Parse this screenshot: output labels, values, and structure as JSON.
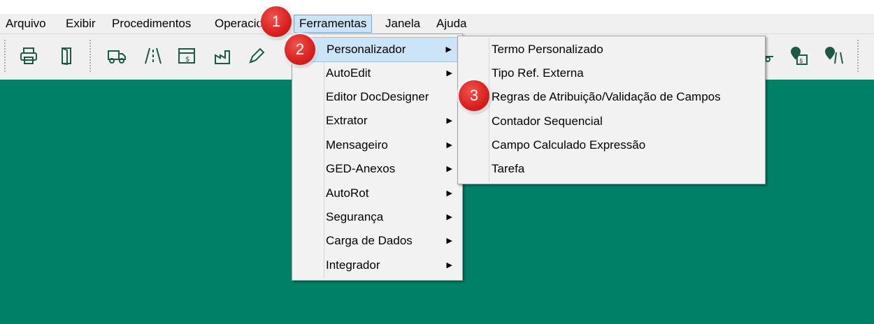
{
  "menubar": {
    "items": [
      "Arquivo",
      "Exibir",
      "Procedimentos",
      "Operacional",
      "Ferramentas",
      "Janela",
      "Ajuda"
    ]
  },
  "toolbar": {
    "icons": [
      "printer-icon",
      "door-exit-icon",
      "truck-icon",
      "road-icon",
      "calculator-money-icon",
      "factory-icon",
      "pen-icon",
      "location-money-icon",
      "location-road-icon"
    ]
  },
  "ferramentas_menu": {
    "items": [
      {
        "label": "Personalizador",
        "submenu": true
      },
      {
        "label": "AutoEdit",
        "submenu": true
      },
      {
        "label": "Editor DocDesigner",
        "submenu": false
      },
      {
        "label": "Extrator",
        "submenu": true
      },
      {
        "label": "Mensageiro",
        "submenu": true
      },
      {
        "label": "GED-Anexos",
        "submenu": true
      },
      {
        "label": "AutoRot",
        "submenu": true
      },
      {
        "label": "Segurança",
        "submenu": true
      },
      {
        "label": "Carga de Dados",
        "submenu": true
      },
      {
        "label": "Integrador",
        "submenu": true
      }
    ]
  },
  "personalizador_submenu": {
    "items": [
      "Termo Personalizado",
      "Tipo Ref. Externa",
      "Regras de Atribuição/Validação de Campos",
      "Contador Sequencial",
      "Campo Calculado Expressão",
      "Tarefa"
    ]
  },
  "annotations": {
    "step1": "1",
    "step2": "2",
    "step3": "3"
  },
  "colors": {
    "background": "#008066",
    "highlight": "#cce4f7",
    "badge": "#d9201e",
    "icon": "#1c5a45"
  }
}
